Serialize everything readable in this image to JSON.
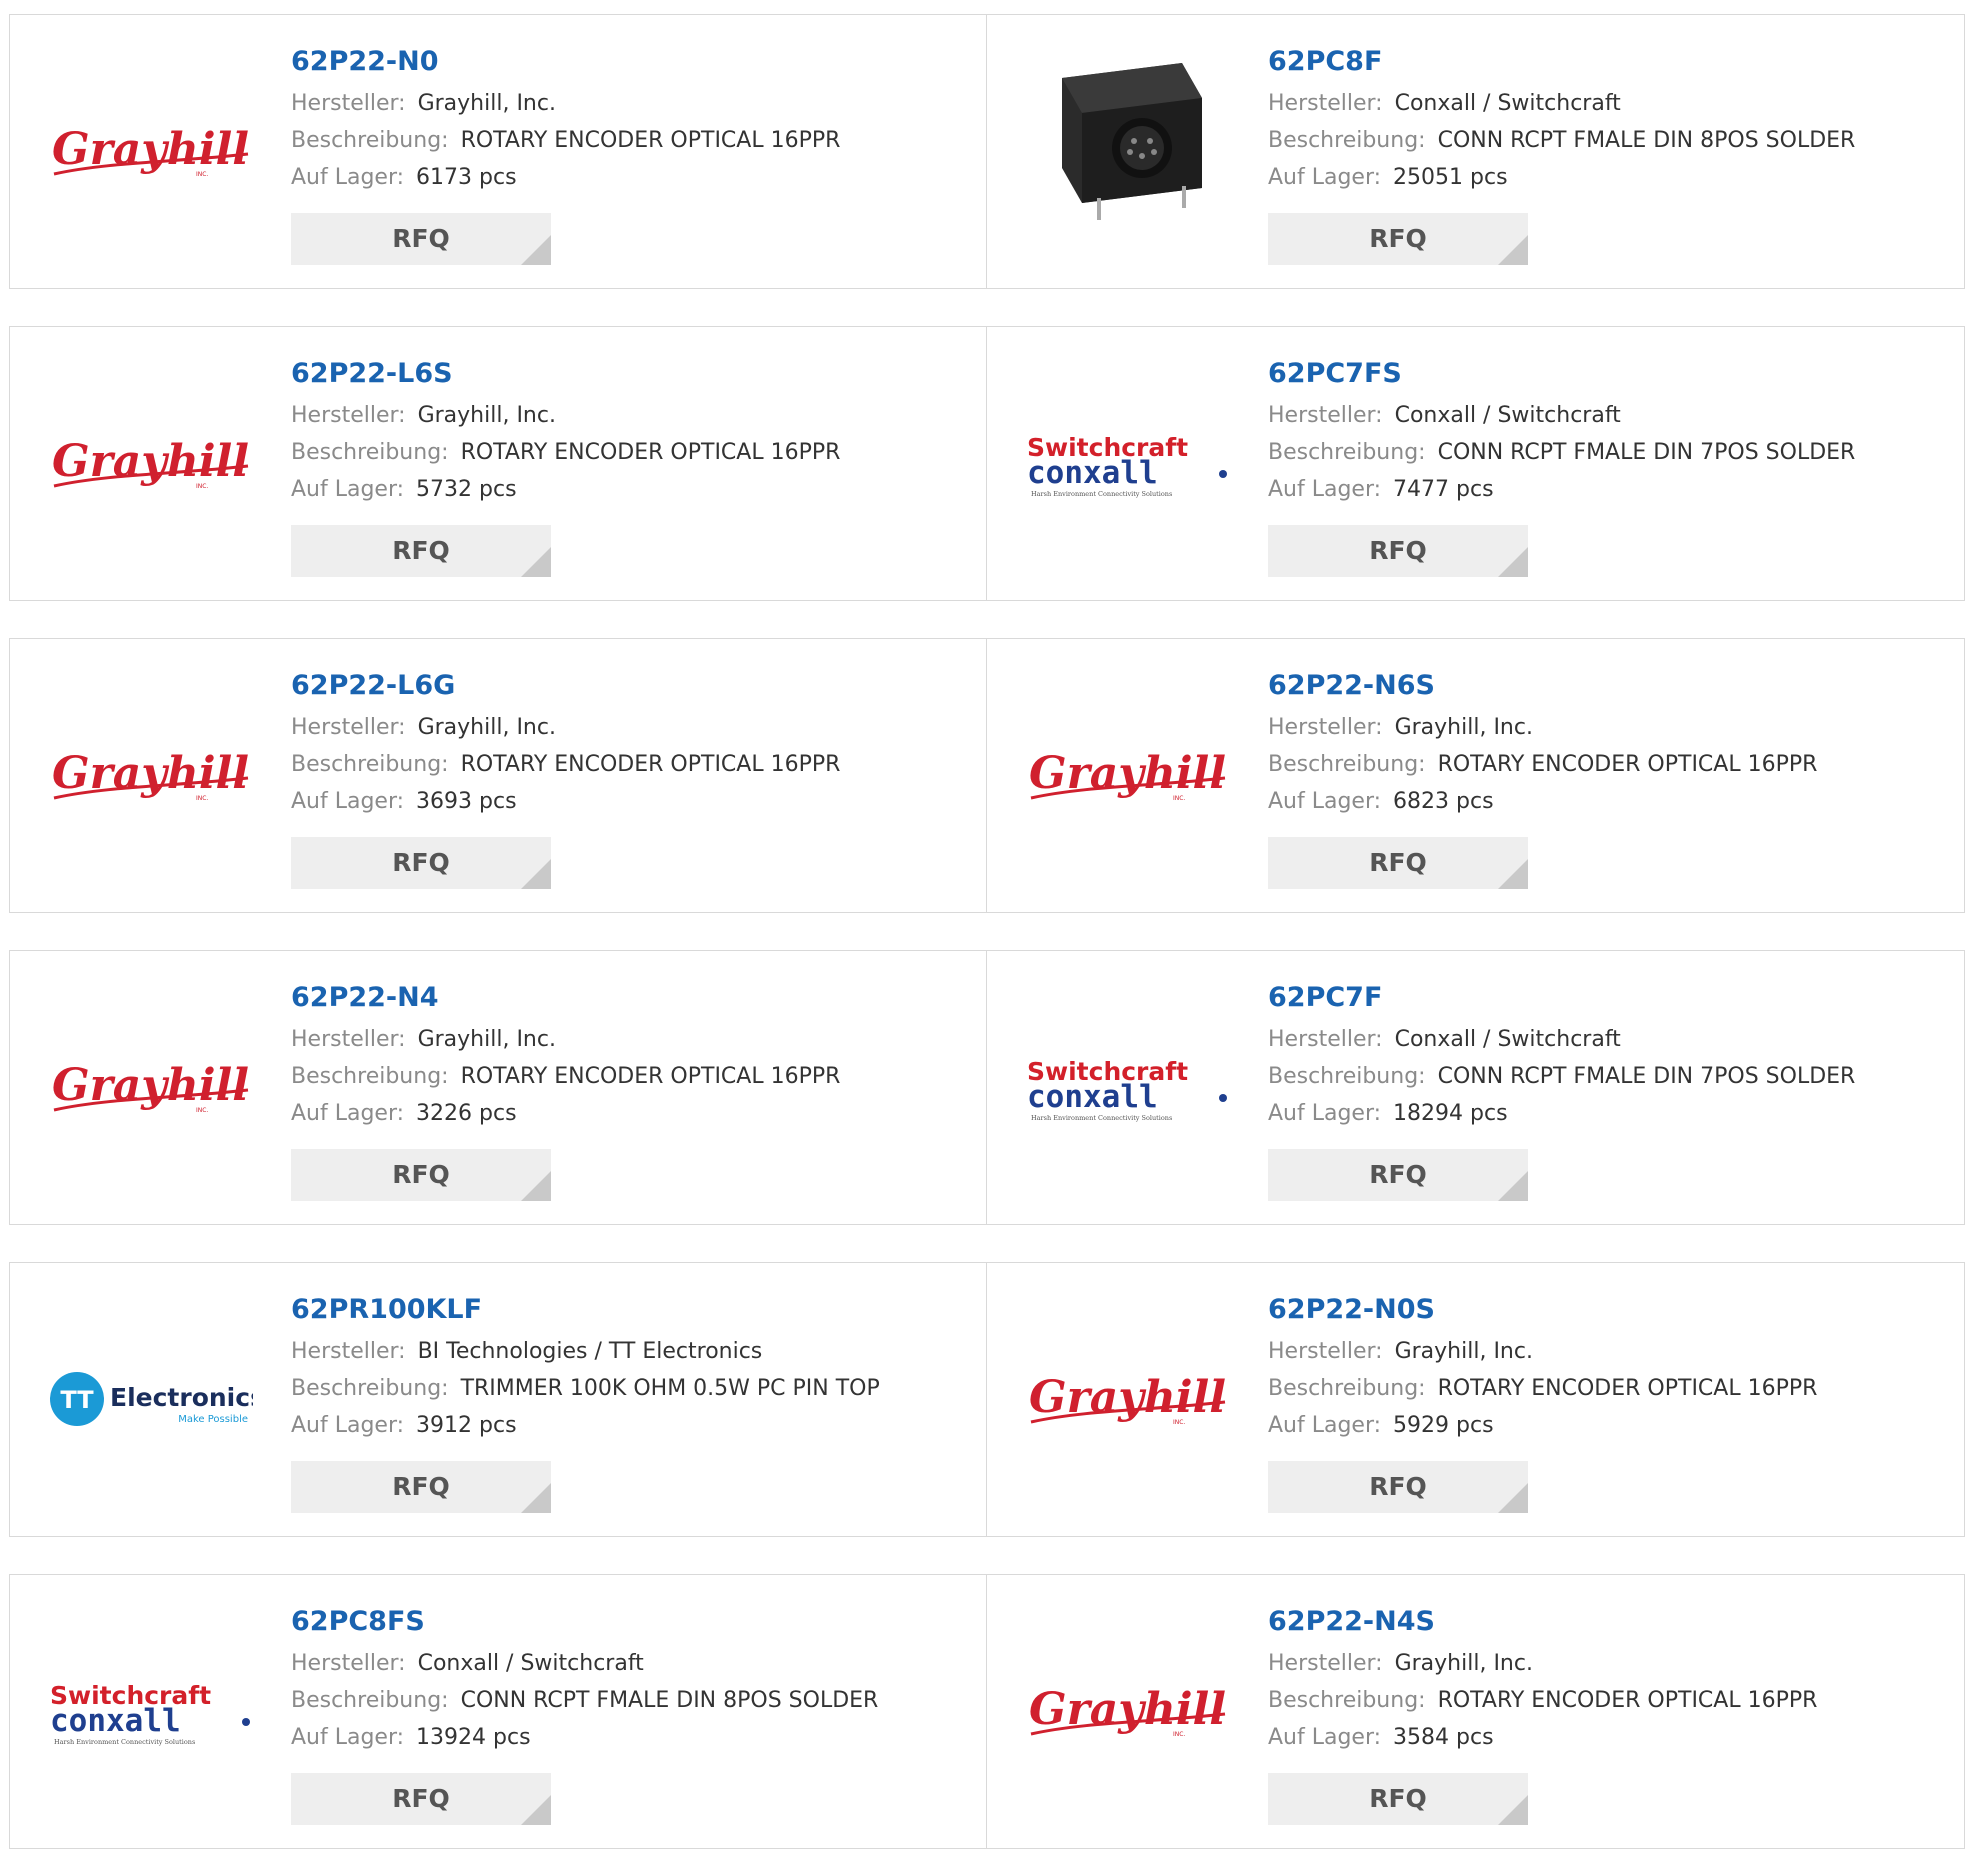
{
  "labels": {
    "manufacturer": "Hersteller:",
    "description": "Beschreibung:",
    "stock": "Auf Lager:",
    "rfq": "RFQ"
  },
  "logo_text": {
    "grayhill": "Grayhill",
    "grayhill_inc": "INC.",
    "switchcraft": "Switchcraft",
    "conxall": "conxall",
    "conxall_tagline": "Harsh Environment Connectivity Solutions",
    "tt_mark": "TT",
    "tt_name": "Electronics",
    "tt_tagline": "Make Possible"
  },
  "products": [
    {
      "pn": "62P22-N0",
      "manufacturer": "Grayhill, Inc.",
      "description": "ROTARY ENCODER OPTICAL 16PPR",
      "stock": "6173 pcs",
      "logo": "grayhill-logo"
    },
    {
      "pn": "62PC8F",
      "manufacturer": "Conxall / Switchcraft",
      "description": "CONN RCPT FMALE DIN 8POS SOLDER",
      "stock": "25051 pcs",
      "logo": "connector-photo"
    },
    {
      "pn": "62P22-L6S",
      "manufacturer": "Grayhill, Inc.",
      "description": "ROTARY ENCODER OPTICAL 16PPR",
      "stock": "5732 pcs",
      "logo": "grayhill-logo"
    },
    {
      "pn": "62PC7FS",
      "manufacturer": "Conxall / Switchcraft",
      "description": "CONN RCPT FMALE DIN 7POS SOLDER",
      "stock": "7477 pcs",
      "logo": "switchcraft-conxall-logo"
    },
    {
      "pn": "62P22-L6G",
      "manufacturer": "Grayhill, Inc.",
      "description": "ROTARY ENCODER OPTICAL 16PPR",
      "stock": "3693 pcs",
      "logo": "grayhill-logo"
    },
    {
      "pn": "62P22-N6S",
      "manufacturer": "Grayhill, Inc.",
      "description": "ROTARY ENCODER OPTICAL 16PPR",
      "stock": "6823 pcs",
      "logo": "grayhill-logo"
    },
    {
      "pn": "62P22-N4",
      "manufacturer": "Grayhill, Inc.",
      "description": "ROTARY ENCODER OPTICAL 16PPR",
      "stock": "3226 pcs",
      "logo": "grayhill-logo"
    },
    {
      "pn": "62PC7F",
      "manufacturer": "Conxall / Switchcraft",
      "description": "CONN RCPT FMALE DIN 7POS SOLDER",
      "stock": "18294 pcs",
      "logo": "switchcraft-conxall-logo"
    },
    {
      "pn": "62PR100KLF",
      "manufacturer": "BI Technologies / TT Electronics",
      "description": "TRIMMER 100K OHM 0.5W PC PIN TOP",
      "stock": "3912 pcs",
      "logo": "tt-electronics-logo"
    },
    {
      "pn": "62P22-N0S",
      "manufacturer": "Grayhill, Inc.",
      "description": "ROTARY ENCODER OPTICAL 16PPR",
      "stock": "5929 pcs",
      "logo": "grayhill-logo"
    },
    {
      "pn": "62PC8FS",
      "manufacturer": "Conxall / Switchcraft",
      "description": "CONN RCPT FMALE DIN 8POS SOLDER",
      "stock": "13924 pcs",
      "logo": "switchcraft-conxall-logo"
    },
    {
      "pn": "62P22-N4S",
      "manufacturer": "Grayhill, Inc.",
      "description": "ROTARY ENCODER OPTICAL 16PPR",
      "stock": "3584 pcs",
      "logo": "grayhill-logo"
    }
  ],
  "colors": {
    "part_link": "#1a63b0",
    "grayhill_red": "#d0202e",
    "switchcraft_red": "#d3202a",
    "conxall_navy": "#1f3f8f",
    "tt_blue": "#1b9ad6"
  }
}
